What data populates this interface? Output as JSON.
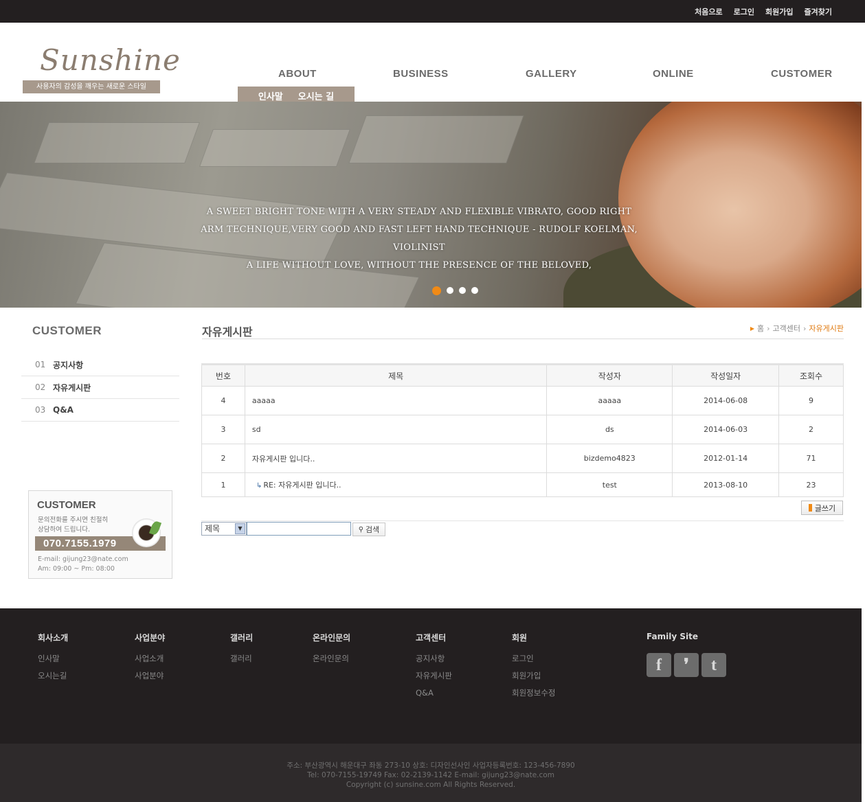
{
  "top_links": [
    "처음으로",
    "로그인",
    "회원가입",
    "즐겨찾기"
  ],
  "logo": {
    "name": "Sunshine",
    "tagline": "사용자의 감성을 깨우는 새로운 스타일"
  },
  "gnb": [
    "ABOUT",
    "BUSINESS",
    "GALLERY",
    "ONLINE",
    "CUSTOMER"
  ],
  "subnav": [
    "인사말",
    "오시는 길"
  ],
  "hero": {
    "lines": [
      "A SWEET BRIGHT TONE WITH A VERY STEADY AND FLEXIBLE VIBRATO, GOOD RIGHT",
      "ARM TECHNIQUE,VERY GOOD AND FAST LEFT HAND TECHNIQUE - RUDOLF KOELMAN, VIOLINIST",
      "A LIFE WITHOUT LOVE, WITHOUT THE PRESENCE OF THE BELOVED,"
    ],
    "slides": 4,
    "active_slide": 1,
    "accent": "#f08a16"
  },
  "sidebar": {
    "title": "CUSTOMER",
    "items": [
      {
        "num": "01",
        "label": "공지사항"
      },
      {
        "num": "02",
        "label": "자유게시판"
      },
      {
        "num": "03",
        "label": "Q&A"
      }
    ],
    "cs": {
      "title": "CUSTOMER",
      "desc1": "문의전화를 주시면 친절히",
      "desc2": "상담하여 드립니다.",
      "phone": "070.7155.1979",
      "email": "E-mail: gijung23@nate.com",
      "hours": "Am: 09:00 ~ Pm: 08:00"
    }
  },
  "page": {
    "title": "자유게시판",
    "breadcrumb": [
      "홈",
      "고객센터",
      "자유게시판"
    ]
  },
  "board": {
    "headers": [
      "번호",
      "제목",
      "작성자",
      "작성일자",
      "조회수"
    ],
    "rows": [
      {
        "no": "4",
        "subject": "aaaaa",
        "writer": "aaaaa",
        "date": "2014-06-08",
        "views": "9"
      },
      {
        "no": "3",
        "subject": "sd",
        "writer": "ds",
        "date": "2014-06-03",
        "views": "2"
      },
      {
        "no": "2",
        "subject": "자유게시판 입니다..",
        "writer": "bizdemo4823",
        "date": "2012-01-14",
        "views": "71"
      },
      {
        "no": "1",
        "reply_prefix": "↳",
        "subject": "RE: 자유게시판 입니다..",
        "writer": "test",
        "date": "2013-08-10",
        "views": "23"
      }
    ],
    "write_label": "글쓰기",
    "search": {
      "field": "제목",
      "value": "",
      "button": "검색"
    }
  },
  "footer": {
    "cols": [
      {
        "title": "회사소개",
        "links": [
          "인사말",
          "오시는길"
        ]
      },
      {
        "title": "사업분야",
        "links": [
          "사업소개",
          "사업분야"
        ]
      },
      {
        "title": "갤러리",
        "links": [
          "갤러리"
        ]
      },
      {
        "title": "온라인문의",
        "links": [
          "온라인문의"
        ]
      },
      {
        "title": "고객센터",
        "links": [
          "공지사항",
          "자유게시판",
          "Q&A"
        ]
      },
      {
        "title": "회원",
        "links": [
          "로그인",
          "회원가입",
          "회원정보수정"
        ]
      }
    ],
    "family_title": "Family Site",
    "sns": [
      "facebook-icon",
      "blog-icon",
      "twitter-icon"
    ],
    "sns_glyphs": [
      "f",
      "❜",
      "t"
    ],
    "address": "주소: 부산광역시 해운대구 좌동 273-10  상호: 디자인선사인  사업자등록번호: 123-456-7890",
    "contact": "Tel: 070-7155-19749  Fax: 02-2139-1142  E-mail: gijung23@nate.com",
    "copyright": "Copyright (c) sunsine.com All Rights Reserved."
  }
}
